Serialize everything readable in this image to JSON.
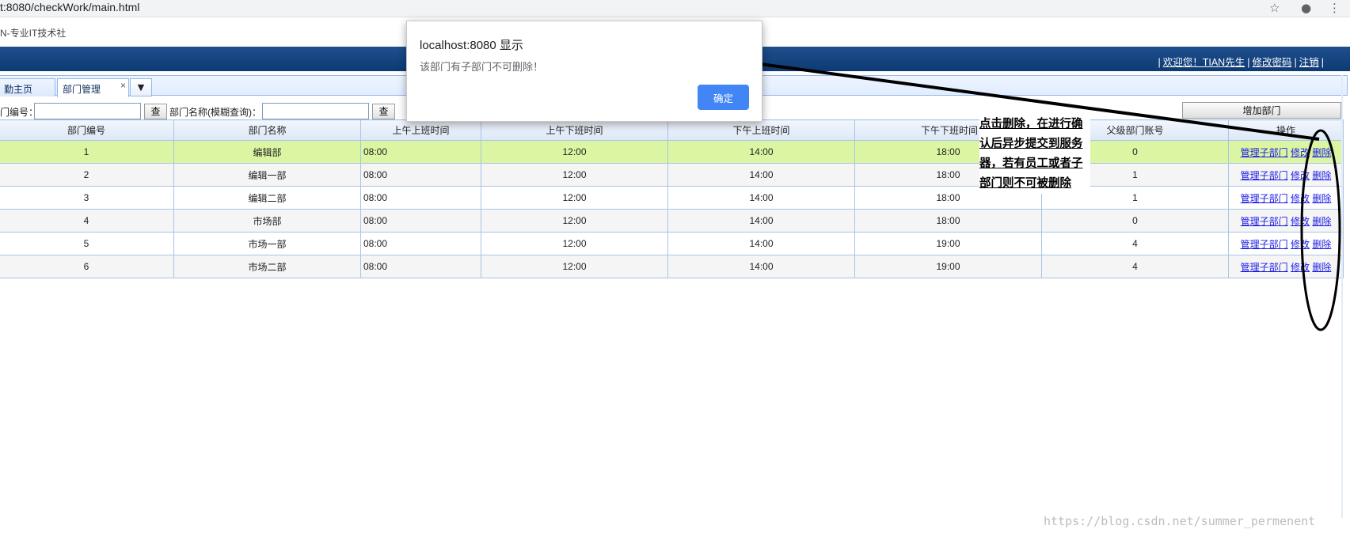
{
  "browser": {
    "url": "t:8080/checkWork/main.html",
    "bookmark": "N-专业IT技术社"
  },
  "header": {
    "separator": "|",
    "welcome": "欢迎您！TIAN先生",
    "change_password": "修改密码",
    "logout": "注销"
  },
  "tabs": [
    {
      "label": "勤主页"
    },
    {
      "label": "部门管理",
      "close": "×"
    }
  ],
  "toolbar": {
    "dept_no_label": "门编号：",
    "query_btn": "查询",
    "dept_name_label": "部门名称(模糊查询)：",
    "query_btn2": "查询",
    "add_btn": "增加部门"
  },
  "table": {
    "columns": [
      "部门编号",
      "部门名称",
      "上午上班时间",
      "上午下班时间",
      "下午上班时间",
      "下午下班时间",
      "父级部门账号",
      "操作"
    ],
    "rows": [
      {
        "id": "1",
        "name": "编辑部",
        "am_in": "08:00",
        "am_out": "12:00",
        "pm_in": "14:00",
        "pm_out": "18:00",
        "parent": "0"
      },
      {
        "id": "2",
        "name": "编辑一部",
        "am_in": "08:00",
        "am_out": "12:00",
        "pm_in": "14:00",
        "pm_out": "18:00",
        "parent": "1"
      },
      {
        "id": "3",
        "name": "编辑二部",
        "am_in": "08:00",
        "am_out": "12:00",
        "pm_in": "14:00",
        "pm_out": "18:00",
        "parent": "1"
      },
      {
        "id": "4",
        "name": "市场部",
        "am_in": "08:00",
        "am_out": "12:00",
        "pm_in": "14:00",
        "pm_out": "18:00",
        "parent": "0"
      },
      {
        "id": "5",
        "name": "市场一部",
        "am_in": "08:00",
        "am_out": "12:00",
        "pm_in": "14:00",
        "pm_out": "19:00",
        "parent": "4"
      },
      {
        "id": "6",
        "name": "市场二部",
        "am_in": "08:00",
        "am_out": "12:00",
        "pm_in": "14:00",
        "pm_out": "19:00",
        "parent": "4"
      }
    ],
    "actions": {
      "manage": "管理子部门",
      "edit": "修改",
      "delete": "删除"
    }
  },
  "annotation": {
    "text": "点击删除，在进行确认后异步提交到服务器，若有员工或者子部门则不可被删除"
  },
  "dialog": {
    "title": "localhost:8080 显示",
    "message": "该部门有子部门不可删除！",
    "ok": "确定",
    "ok_color": "#4285f4"
  },
  "watermark": "https://blog.csdn.net/summer_permenent"
}
